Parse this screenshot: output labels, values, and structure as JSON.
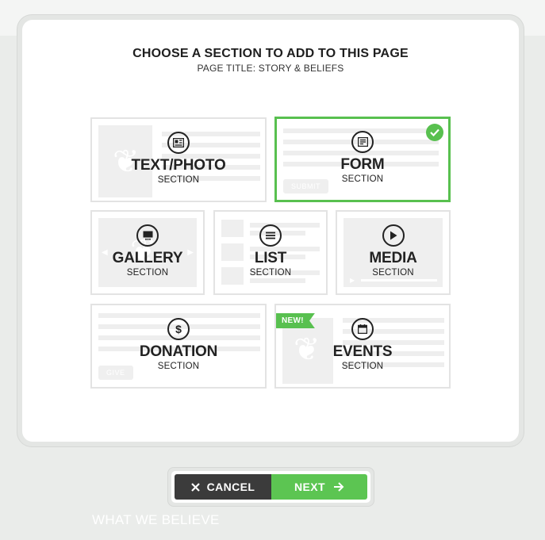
{
  "modal": {
    "title": "CHOOSE A SECTION TO ADD TO THIS PAGE",
    "subtitle": "PAGE TITLE: STORY & BELIEFS"
  },
  "sections": {
    "text_photo": {
      "title": "TEXT/PHOTO",
      "sub": "SECTION",
      "icon": "text-photo-icon"
    },
    "form": {
      "title": "FORM",
      "sub": "SECTION",
      "icon": "form-icon",
      "selected": true,
      "thumb_button": "SUBMIT"
    },
    "gallery": {
      "title": "GALLERY",
      "sub": "SECTION",
      "icon": "gallery-icon"
    },
    "list": {
      "title": "LIST",
      "sub": "SECTION",
      "icon": "list-icon"
    },
    "media": {
      "title": "MEDIA",
      "sub": "SECTION",
      "icon": "play-icon"
    },
    "donation": {
      "title": "DONATION",
      "sub": "SECTION",
      "icon": "dollar-icon",
      "thumb_button": "GIVE"
    },
    "events": {
      "title": "EVENTS",
      "sub": "SECTION",
      "icon": "calendar-icon",
      "badge": "NEW!"
    }
  },
  "buttons": {
    "cancel": "CANCEL",
    "next": "NEXT"
  },
  "background": {
    "footer_text": "WHAT WE BELIEVE"
  },
  "colors": {
    "accent": "#58c04f",
    "dark_button": "#3b3b3b",
    "text": "#222222"
  }
}
